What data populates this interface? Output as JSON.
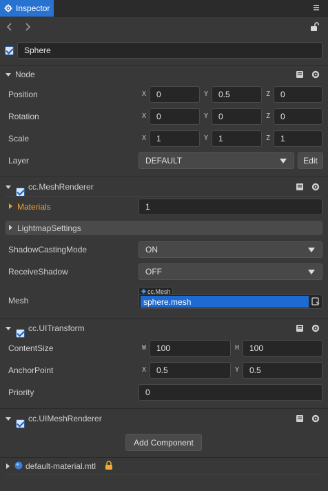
{
  "tab": {
    "title": "Inspector"
  },
  "node_name": "Sphere",
  "node": {
    "title": "Node",
    "position": {
      "label": "Position",
      "x": "0",
      "y": "0.5",
      "z": "0"
    },
    "rotation": {
      "label": "Rotation",
      "x": "0",
      "y": "0",
      "z": "0"
    },
    "scale": {
      "label": "Scale",
      "x": "1",
      "y": "1",
      "z": "1"
    },
    "layer": {
      "label": "Layer",
      "value": "DEFAULT",
      "edit_label": "Edit"
    }
  },
  "axes": {
    "x": "X",
    "y": "Y",
    "z": "Z",
    "w": "W",
    "h": "H"
  },
  "mesh_renderer": {
    "title": "cc.MeshRenderer",
    "materials": {
      "label": "Materials",
      "value": "1"
    },
    "lightmap": {
      "label": "LightmapSettings"
    },
    "shadow_casting": {
      "label": "ShadowCastingMode",
      "value": "ON"
    },
    "receive_shadow": {
      "label": "ReceiveShadow",
      "value": "OFF"
    },
    "mesh": {
      "label": "Mesh",
      "type": "cc.Mesh",
      "value": "sphere.mesh"
    }
  },
  "ui_transform": {
    "title": "cc.UITransform",
    "content_size": {
      "label": "ContentSize",
      "w": "100",
      "h": "100"
    },
    "anchor_point": {
      "label": "AnchorPoint",
      "x": "0.5",
      "y": "0.5"
    },
    "priority": {
      "label": "Priority",
      "value": "0"
    }
  },
  "ui_mesh_renderer": {
    "title": "cc.UIMeshRenderer"
  },
  "add_component": {
    "label": "Add Component"
  },
  "material": {
    "label": "default-material.mtl"
  },
  "colors": {
    "accent": "#2873d1",
    "materials_label": "#f0a030",
    "lock": "#f0a830"
  },
  "icons": [
    "gear-icon",
    "menu-icon",
    "arrow-left-icon",
    "arrow-right-icon",
    "unlock-icon",
    "book-icon",
    "settings-icon",
    "lock-icon",
    "material-sphere-icon",
    "select-asset-icon"
  ]
}
